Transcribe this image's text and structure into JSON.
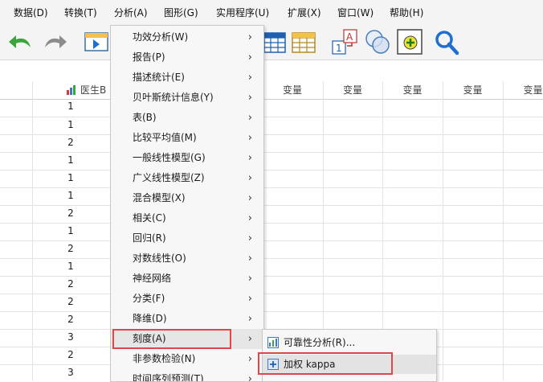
{
  "menubar": {
    "items": [
      {
        "label": "数据(D)"
      },
      {
        "label": "转换(T)"
      },
      {
        "label": "分析(A)"
      },
      {
        "label": "图形(G)"
      },
      {
        "label": "实用程序(U)"
      },
      {
        "label": "扩展(X)"
      },
      {
        "label": "窗口(W)"
      },
      {
        "label": "帮助(H)"
      }
    ]
  },
  "toolbar": {
    "icons": [
      "undo-icon",
      "redo-icon",
      "goto-case-icon",
      "insert-variable-icon",
      "split-file-icon",
      "weight-cases-icon",
      "value-labels-icon",
      "use-sets-icon",
      "find-icon"
    ]
  },
  "grid": {
    "first_column_header": "医生B",
    "variable_header": "变量",
    "values": [
      "1",
      "1",
      "2",
      "1",
      "1",
      "1",
      "2",
      "1",
      "2",
      "1",
      "2",
      "2",
      "2",
      "3",
      "2",
      "3"
    ]
  },
  "analyze_menu": {
    "items": [
      {
        "label": "功效分析(W)",
        "has_submenu": true
      },
      {
        "label": "报告(P)",
        "has_submenu": true
      },
      {
        "label": "描述统计(E)",
        "has_submenu": true
      },
      {
        "label": "贝叶斯统计信息(Y)",
        "has_submenu": true
      },
      {
        "label": "表(B)",
        "has_submenu": true
      },
      {
        "label": "比较平均值(M)",
        "has_submenu": true
      },
      {
        "label": "一般线性模型(G)",
        "has_submenu": true
      },
      {
        "label": "广义线性模型(Z)",
        "has_submenu": true
      },
      {
        "label": "混合模型(X)",
        "has_submenu": true
      },
      {
        "label": "相关(C)",
        "has_submenu": true
      },
      {
        "label": "回归(R)",
        "has_submenu": true
      },
      {
        "label": "对数线性(O)",
        "has_submenu": true
      },
      {
        "label": "神经网络",
        "has_submenu": true
      },
      {
        "label": "分类(F)",
        "has_submenu": true
      },
      {
        "label": "降维(D)",
        "has_submenu": true
      },
      {
        "label": "刻度(A)",
        "has_submenu": true
      },
      {
        "label": "非参数检验(N)",
        "has_submenu": true
      },
      {
        "label": "时间序列预测(T)",
        "has_submenu": true
      }
    ],
    "arrow": "›"
  },
  "scale_submenu": {
    "items": [
      {
        "label": "可靠性分析(R)..."
      },
      {
        "label": "加权 kappa"
      }
    ]
  },
  "colors": {
    "highlight_border": "#e04848",
    "accent_blue": "#1f6fd1",
    "undo_green": "#3aa53a"
  }
}
